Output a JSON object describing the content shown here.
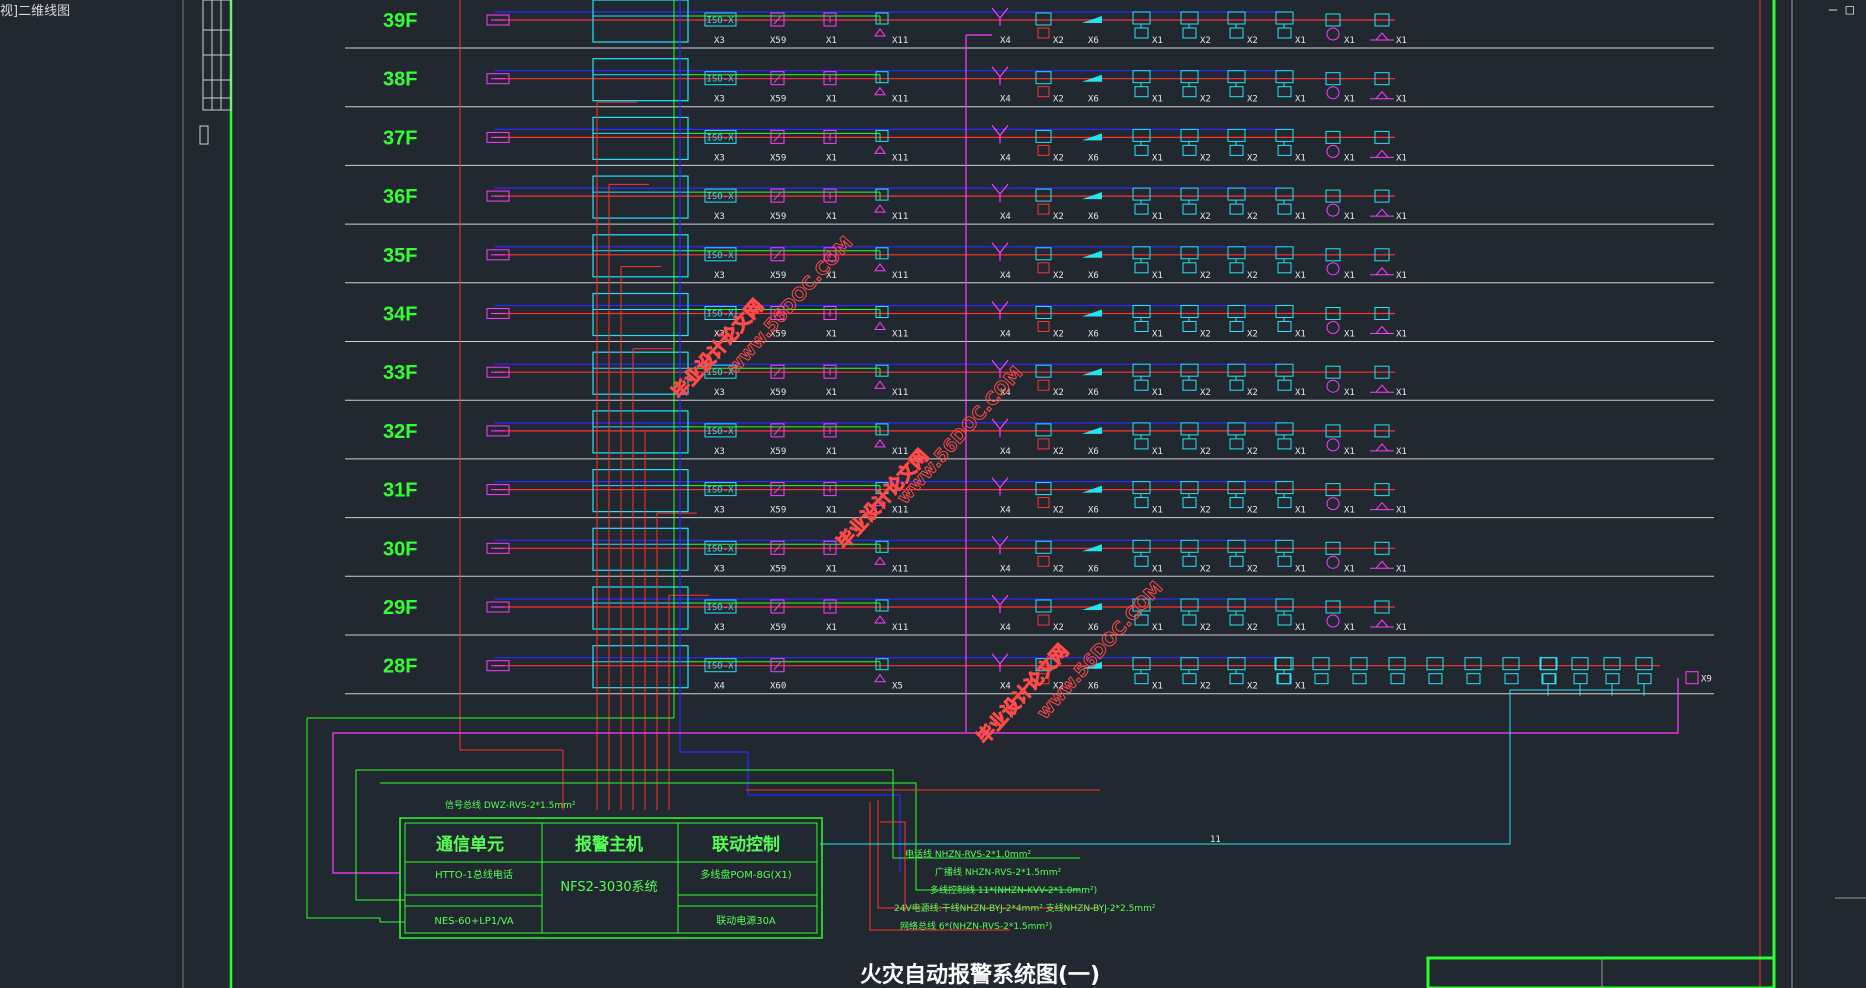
{
  "viewport_label": "视]二维线图",
  "window_controls": [
    "–",
    "□"
  ],
  "floors": [
    "39F",
    "38F",
    "37F",
    "36F",
    "35F",
    "34F",
    "33F",
    "32F",
    "31F",
    "30F",
    "29F",
    "28F"
  ],
  "device_labels": {
    "iso": "ISO-X",
    "counts": {
      "iso": "X3",
      "smoke": "X59",
      "manual": "X1",
      "hydrant": "X11",
      "bell": "X4",
      "module_c": "X2",
      "strobe": "X6",
      "module": "X1",
      "module2": "X2",
      "module3": "X2",
      "module4": "X1",
      "pump": "X1",
      "valve": "X1"
    },
    "counts_28f": {
      "iso": "X4",
      "smoke": "X60",
      "hydrant": "X5"
    },
    "tag_extra": "X9",
    "bus_note": "11"
  },
  "controller": {
    "headers": [
      "通信单元",
      "报警主机",
      "联动控制"
    ],
    "comm_rows": [
      "HTTO-1总线电话",
      "NES-60+LP1/VA"
    ],
    "host": "NFS2-3030系统",
    "link_rows": [
      "多线盘POM-8G(X1)",
      "联动电源30A"
    ],
    "bus_label": "信号总线 DWZ-RVS-2*1.5mm²"
  },
  "legend": [
    "电话线  NHZN-RVS-2*1.0mm²",
    "广播线  NHZN-RVS-2*1.5mm²",
    "多线控制线  11*(NHZN-KVV-2*1.0mm²)",
    "24V电源线:干线NHZN-BYJ-2*4mm²  支线NHZN-BYJ-2*2.5mm²",
    "网络总线  6*(NHZN-RVS-2*1.5mm²)"
  ],
  "title": "火灾自动报警系统图(一)",
  "watermarks": [
    "毕业设计论文网",
    "www.56DOC.COM"
  ],
  "colors": {
    "background": "#212830",
    "green": "#2bff2b",
    "red": "#ff3232",
    "blue": "#2a2aff",
    "cyan": "#25e4f2",
    "magenta": "#ff3cff",
    "floorline": "#d0d0d0"
  }
}
